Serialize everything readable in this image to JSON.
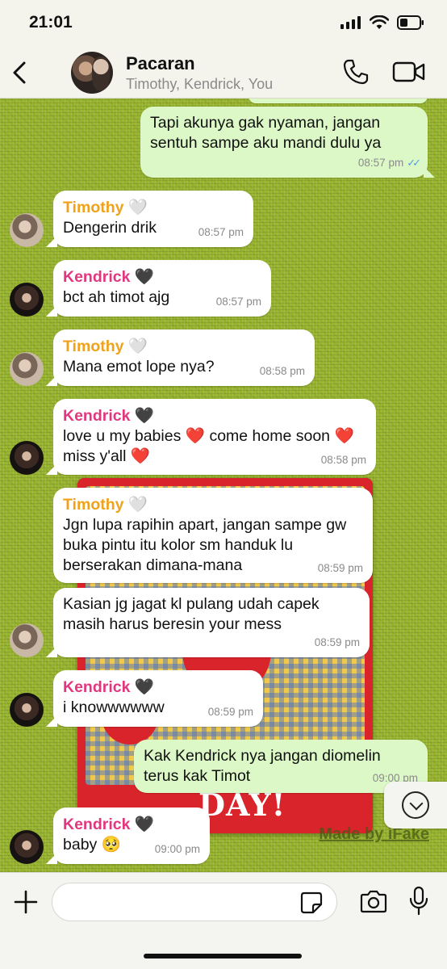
{
  "status_bar": {
    "time": "21:01"
  },
  "header": {
    "title": "Pacaran",
    "subtitle": "Timothy, Kendrick, You"
  },
  "icons": {
    "back": "chevron-left-icon",
    "call": "phone-icon",
    "video": "video-camera-icon",
    "plus": "plus-icon",
    "sticker": "sticker-icon",
    "camera": "camera-icon",
    "mic": "microphone-icon",
    "scroll": "chevron-down-circle-icon"
  },
  "colors": {
    "timothy": "#f0a21c",
    "kendrick": "#e2367f",
    "outgoing_bubble": "#dcf8c6",
    "chat_bg": "#98b52c",
    "read_ticks": "#4fa0e8"
  },
  "messages": [
    {
      "sender": "",
      "text": "Tapi akunya gak nyaman, jangan sentuh sampe aku mandi dulu ya",
      "time": "08:57 pm",
      "read": "✓✓"
    },
    {
      "sender": "Timothy 🤍",
      "text": "Dengerin drik",
      "time": "08:57 pm"
    },
    {
      "sender": "Kendrick 🖤",
      "text": "bct ah timot ajg",
      "time": "08:57 pm"
    },
    {
      "sender": "Timothy 🤍",
      "text": "Mana emot lope nya?",
      "time": "08:58 pm"
    },
    {
      "sender": "Kendrick 🖤",
      "text": "love u my babies ❤️ come home soon ❤️ miss y'all ❤️",
      "time": "08:58 pm"
    },
    {
      "sender": "Timothy 🤍",
      "text": "Jgn lupa rapihin apart, jangan sampe gw buka pintu itu kolor sm handuk lu berserakan dimana-mana",
      "time": "08:59 pm"
    },
    {
      "sender": "",
      "text": "Kasian jg jagat kl pulang udah capek masih harus beresin your mess",
      "time": "08:59 pm"
    },
    {
      "sender": "Kendrick 🖤",
      "text": "i knowwwwww",
      "time": "08:59 pm"
    },
    {
      "sender": "",
      "text": "Kak Kendrick nya jangan diomelin terus kak Timot",
      "time": "09:00 pm"
    },
    {
      "sender": "Kendrick 🖤",
      "text": "baby 🥺",
      "time": "09:00 pm"
    }
  ],
  "wallpaper_text": "DAY!",
  "watermark": "Made by iFake",
  "input": {
    "placeholder": "",
    "value": ""
  }
}
